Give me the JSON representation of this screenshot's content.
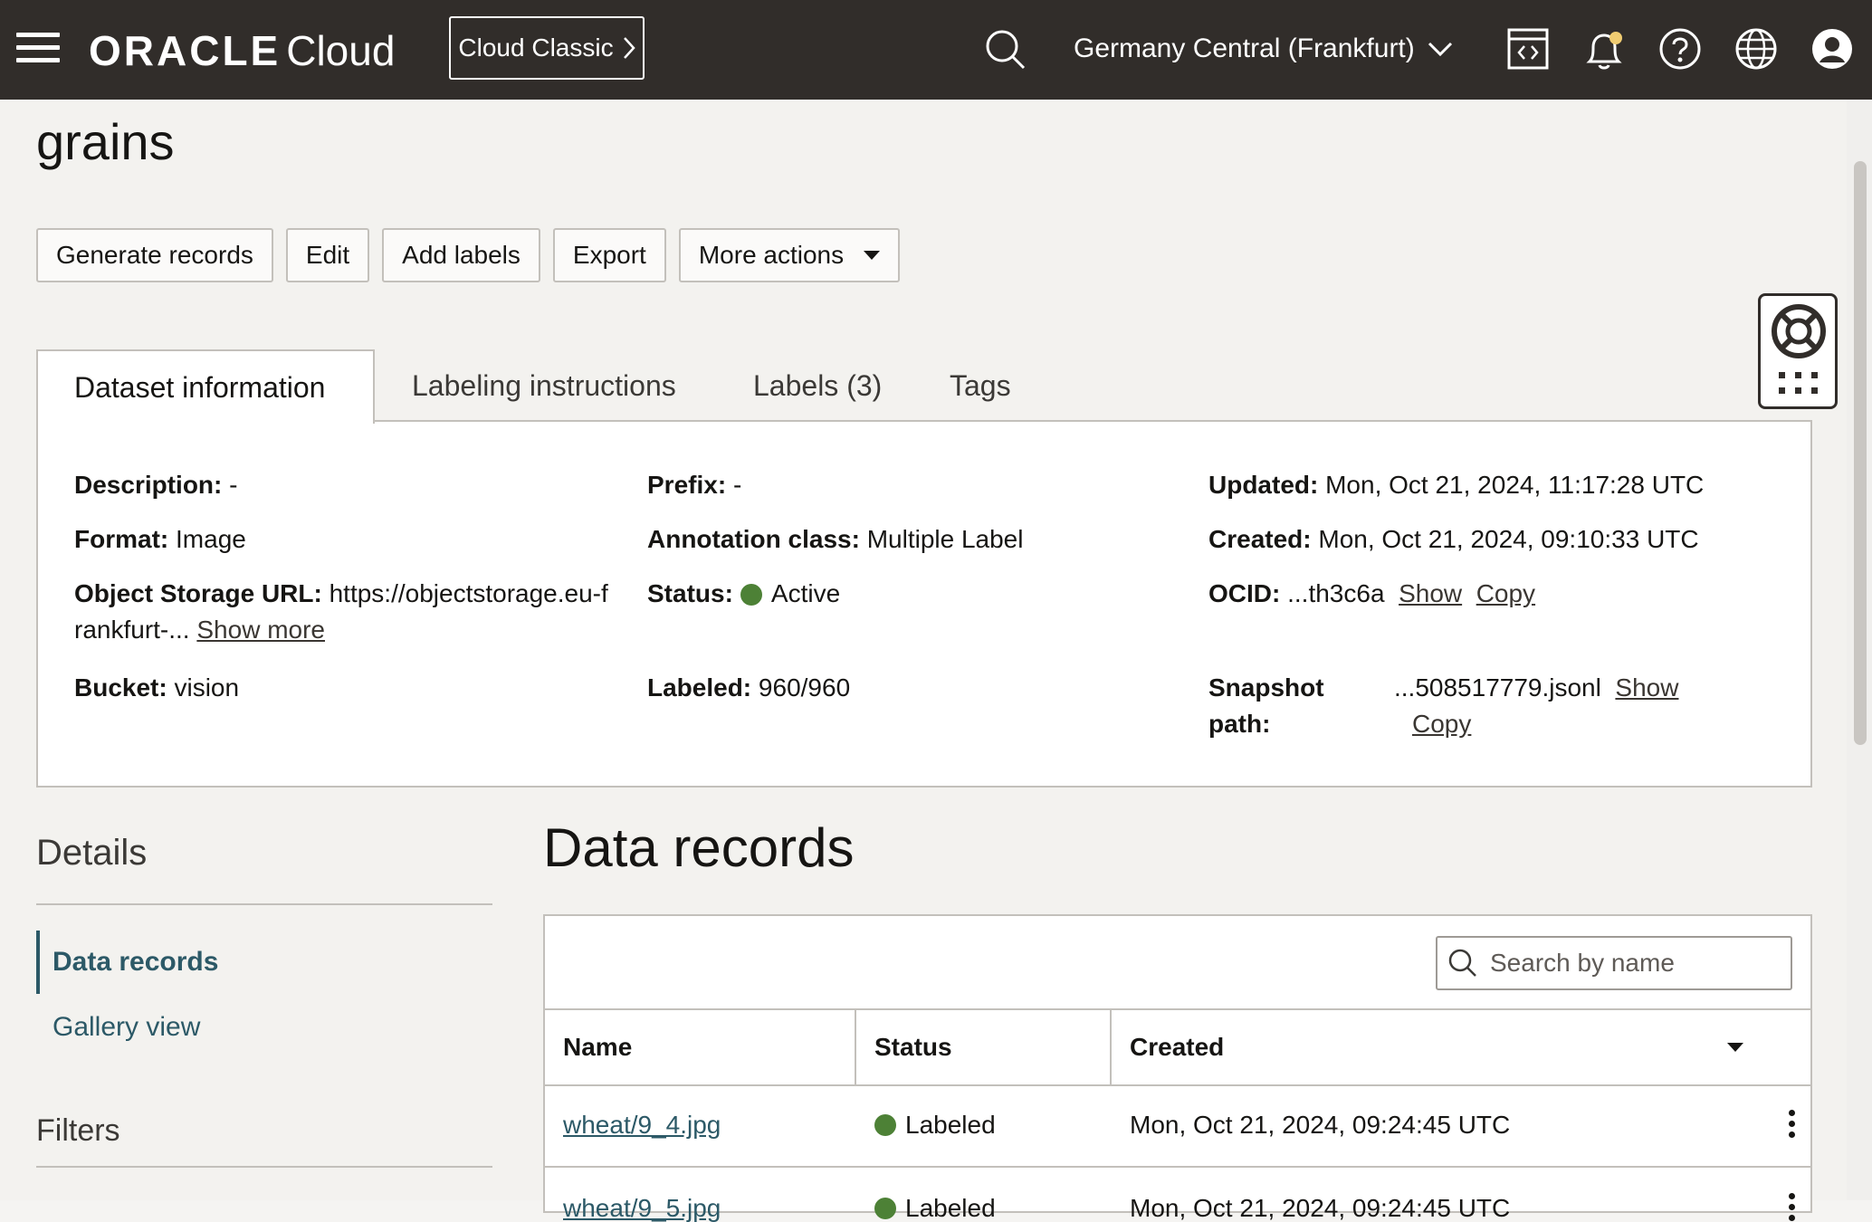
{
  "header": {
    "brand": "ORACLE",
    "product": "Cloud",
    "cloud_classic_label": "Cloud Classic",
    "region": "Germany Central (Frankfurt)"
  },
  "page": {
    "title": "grains"
  },
  "actions": {
    "generate_records": "Generate records",
    "edit": "Edit",
    "add_labels": "Add labels",
    "export": "Export",
    "more_actions": "More actions"
  },
  "tabs": {
    "dataset_information": "Dataset information",
    "labeling_instructions": "Labeling instructions",
    "labels": "Labels (3)",
    "tags": "Tags"
  },
  "info": {
    "description_label": "Description:",
    "description_value": "-",
    "format_label": "Format:",
    "format_value": "Image",
    "object_storage_label": "Object Storage URL:",
    "object_storage_value_line1": "https://objectstorage.eu-f",
    "object_storage_value_line2": "rankfurt-...",
    "show_more": "Show more",
    "bucket_label": "Bucket:",
    "bucket_value": "vision",
    "prefix_label": "Prefix:",
    "prefix_value": "-",
    "annotation_label": "Annotation class:",
    "annotation_value": "Multiple Label",
    "status_label": "Status:",
    "status_value": "Active",
    "labeled_label": "Labeled:",
    "labeled_value": "960/960",
    "updated_label": "Updated:",
    "updated_value": "Mon, Oct 21, 2024, 11:17:28 UTC",
    "created_label": "Created:",
    "created_value": "Mon, Oct 21, 2024, 09:10:33 UTC",
    "ocid_label": "OCID:",
    "ocid_value": "...th3c6a",
    "show": "Show",
    "copy": "Copy",
    "snapshot_label_line1": "Snapshot",
    "snapshot_label_line2": "path:",
    "snapshot_value": "...508517779.jsonl"
  },
  "sidebar": {
    "details_title": "Details",
    "items": [
      {
        "label": "Data records"
      },
      {
        "label": "Gallery view"
      }
    ],
    "filters_title": "Filters"
  },
  "records": {
    "title": "Data records",
    "search_placeholder": "Search by name",
    "columns": [
      "Name",
      "Status",
      "Created"
    ],
    "rows": [
      {
        "name": "wheat/9_4.jpg",
        "status": "Labeled",
        "created": "Mon, Oct 21, 2024, 09:24:45 UTC"
      },
      {
        "name": "wheat/9_5.jpg",
        "status": "Labeled",
        "created": "Mon, Oct 21, 2024, 09:24:45 UTC"
      }
    ]
  },
  "colors": {
    "header_bg": "#312d2a",
    "link": "#2c5967",
    "status_green": "#4d8136",
    "notification_dot": "#f0cc71"
  }
}
